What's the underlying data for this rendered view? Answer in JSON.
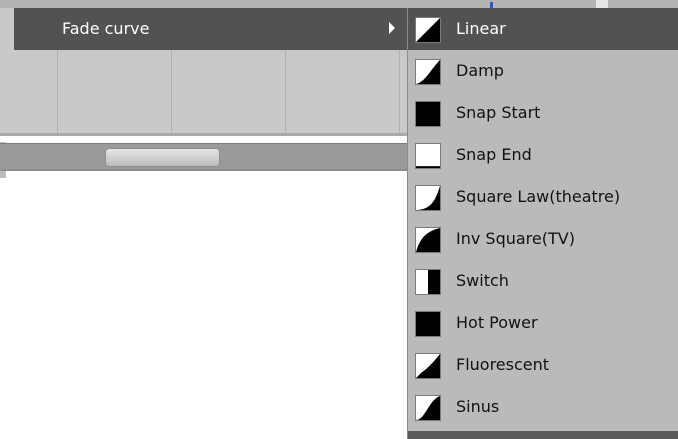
{
  "parent_menu": {
    "label": "Fade curve"
  },
  "submenu": {
    "items": [
      {
        "label": "Linear",
        "icon": "linear-curve-icon",
        "selected": true
      },
      {
        "label": "Damp",
        "icon": "damp-curve-icon",
        "selected": false
      },
      {
        "label": "Snap Start",
        "icon": "snap-start-curve-icon",
        "selected": false
      },
      {
        "label": "Snap End",
        "icon": "snap-end-curve-icon",
        "selected": false
      },
      {
        "label": "Square Law(theatre)",
        "icon": "square-law-curve-icon",
        "selected": false
      },
      {
        "label": "Inv Square(TV)",
        "icon": "inv-square-curve-icon",
        "selected": false
      },
      {
        "label": "Switch",
        "icon": "switch-curve-icon",
        "selected": false
      },
      {
        "label": "Hot Power",
        "icon": "hot-power-curve-icon",
        "selected": false
      },
      {
        "label": "Fluorescent",
        "icon": "fluorescent-curve-icon",
        "selected": false
      },
      {
        "label": "Sinus",
        "icon": "sinus-curve-icon",
        "selected": false
      }
    ]
  },
  "colors": {
    "menu_highlight": "#525252",
    "menu_background": "#bababa",
    "app_background": "#c9c9c9"
  }
}
